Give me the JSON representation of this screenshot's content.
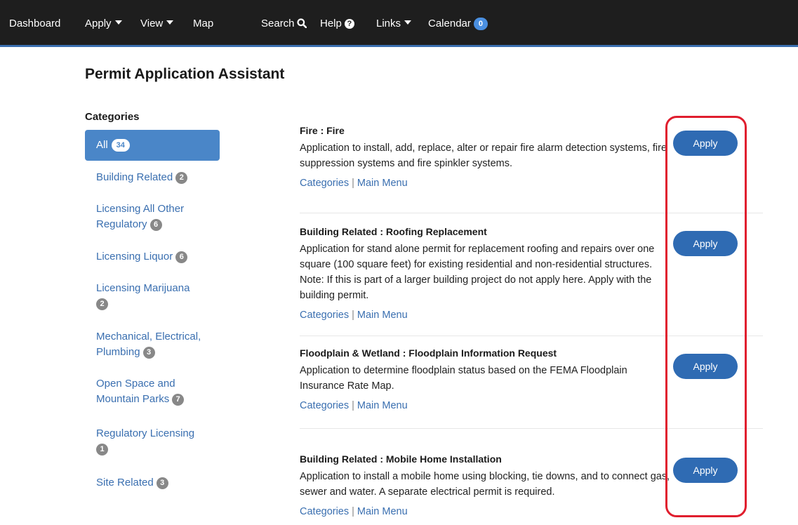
{
  "nav": {
    "dashboard": "Dashboard",
    "apply": "Apply",
    "view": "View",
    "map": "Map",
    "search": "Search",
    "help": "Help",
    "links": "Links",
    "calendar": "Calendar",
    "calendar_count": "0"
  },
  "page": {
    "title": "Permit Application Assistant"
  },
  "sidebar": {
    "heading": "Categories",
    "all": {
      "label": "All",
      "count": "34"
    },
    "items": [
      {
        "label": "Building Related",
        "count": "2"
      },
      {
        "label": "Licensing All Other Regulatory",
        "count": "6"
      },
      {
        "label": "Licensing Liquor",
        "count": "6"
      },
      {
        "label": "Licensing Marijuana",
        "count": "2"
      },
      {
        "label": "Mechanical, Electrical, Plumbing",
        "count": "3"
      },
      {
        "label": "Open Space and Mountain Parks",
        "count": "7"
      },
      {
        "label": "Regulatory Licensing",
        "count": "1"
      },
      {
        "label": "Site Related",
        "count": "3"
      }
    ]
  },
  "entries": [
    {
      "title": "Fire : Fire",
      "description": "Application to install, add, replace, alter or repair fire alarm detection systems, fire suppression systems and fire spinkler systems.",
      "link_categories": "Categories",
      "link_main_menu": "Main Menu",
      "button": "Apply"
    },
    {
      "title": "Building Related : Roofing Replacement",
      "description": "Application for stand alone permit for replacement roofing and repairs over one square (100 square feet) for existing residential and non-residential structures. Note: If this is part of a larger building project do not apply here. Apply with the building permit.",
      "link_categories": "Categories",
      "link_main_menu": "Main Menu",
      "button": "Apply"
    },
    {
      "title": "Floodplain & Wetland : Floodplain Information Request",
      "description": "Application to determine floodplain status based on the FEMA Floodplain Insurance Rate Map.",
      "link_categories": "Categories",
      "link_main_menu": "Main Menu",
      "button": "Apply"
    },
    {
      "title": "Building Related : Mobile Home Installation",
      "description": "Application to install a mobile home using blocking, tie downs, and to connect gas, sewer and water. A separate electrical permit is required.",
      "link_categories": "Categories",
      "link_main_menu": "Main Menu",
      "button": "Apply"
    }
  ],
  "colors": {
    "nav_bg": "#1e1e1e",
    "accent": "#2f6bb3",
    "link": "#3a6fb0",
    "highlight": "#e01e2e"
  }
}
